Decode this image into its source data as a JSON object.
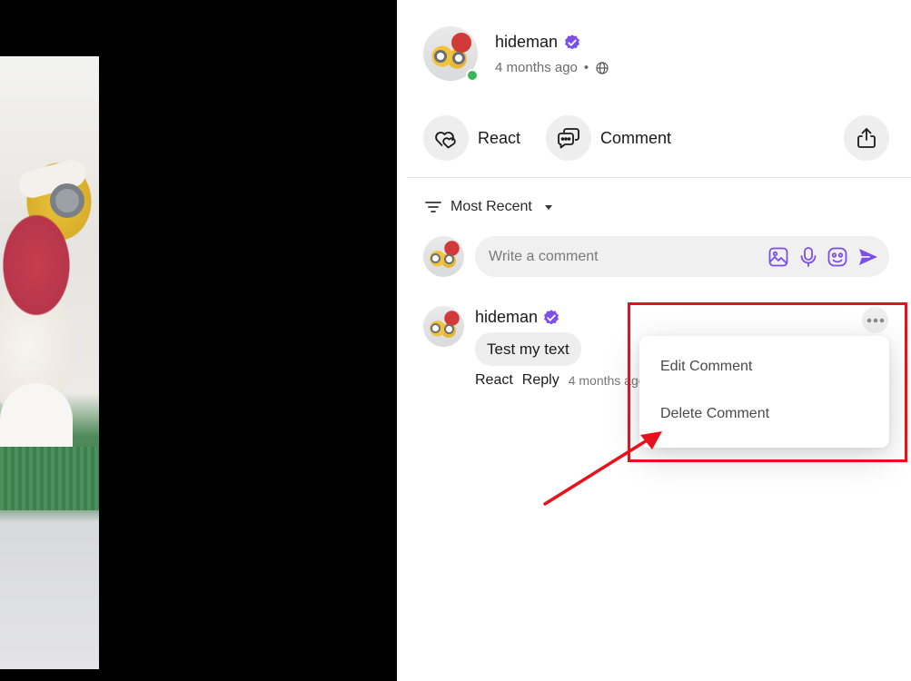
{
  "post": {
    "author_name": "hideman",
    "timestamp": "4 months ago",
    "separator": "•"
  },
  "actions": {
    "react_label": "React",
    "comment_label": "Comment"
  },
  "sort": {
    "label": "Most Recent"
  },
  "composer": {
    "placeholder": "Write a comment"
  },
  "comment": {
    "author_name": "hideman",
    "text": "Test my text",
    "react_label": "React",
    "reply_label": "Reply",
    "timestamp": "4 months ago"
  },
  "menu": {
    "items": [
      {
        "label": "Edit Comment"
      },
      {
        "label": "Delete Comment"
      }
    ]
  },
  "colors": {
    "accent_purple": "#7b4fe8",
    "verified": "#7b4fe8",
    "online": "#3cb55a",
    "annotation_red": "#e8101a"
  }
}
